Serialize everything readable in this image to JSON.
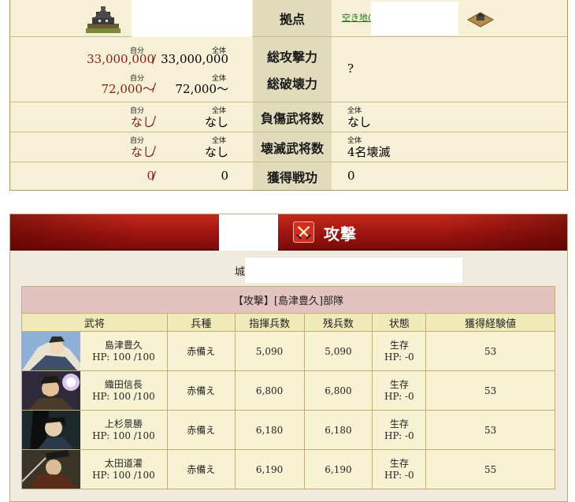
{
  "summary": {
    "base_label": "拠点",
    "vacant_link": "空き地(",
    "attack_label": "総攻撃力",
    "destroy_label": "総破壊力",
    "wounded_label": "負傷武将数",
    "annihilated_label": "壊滅武将数",
    "merit_label": "獲得戦功",
    "self_caption": "自分",
    "all_caption": "全体",
    "attack_self": "33,000,000",
    "attack_all": "33,000,000",
    "destroy_self": "72,000～",
    "destroy_all": "72,000～",
    "defender_power": "?",
    "wounded_self": "なし",
    "wounded_all": "なし",
    "wounded_def": "なし",
    "annihilated_self": "なし",
    "annihilated_all": "なし",
    "annihilated_def": "4名壊滅",
    "merit_self": "0",
    "merit_all": "0",
    "merit_def": "0",
    "slash": "/"
  },
  "banner": {
    "title": "攻撃"
  },
  "lord_label": "城主",
  "unit": {
    "caption": "【攻撃】[島津豊久]部隊",
    "headers": [
      "武将",
      "兵種",
      "指揮兵数",
      "残兵数",
      "状態",
      "獲得経験値"
    ],
    "rows": [
      {
        "name": "島津豊久",
        "hp": "HP: 100 /100",
        "troop": "赤備え",
        "command": "5,090",
        "remain": "5,090",
        "status": "生存",
        "hp_change": "HP: -0",
        "exp": "53"
      },
      {
        "name": "織田信長",
        "hp": "HP: 100 /100",
        "troop": "赤備え",
        "command": "6,800",
        "remain": "6,800",
        "status": "生存",
        "hp_change": "HP: -0",
        "exp": "53"
      },
      {
        "name": "上杉景勝",
        "hp": "HP: 100 /100",
        "troop": "赤備え",
        "command": "6,180",
        "remain": "6,180",
        "status": "生存",
        "hp_change": "HP: -0",
        "exp": "53"
      },
      {
        "name": "太田道灌",
        "hp": "HP: 100 /100",
        "troop": "赤備え",
        "command": "6,190",
        "remain": "6,190",
        "status": "生存",
        "hp_change": "HP: -0",
        "exp": "55"
      }
    ]
  },
  "colors": {
    "banner_red": "#9e1410",
    "panel_beige": "#f5f0d6",
    "accent_red_text": "#8b1a1a"
  }
}
